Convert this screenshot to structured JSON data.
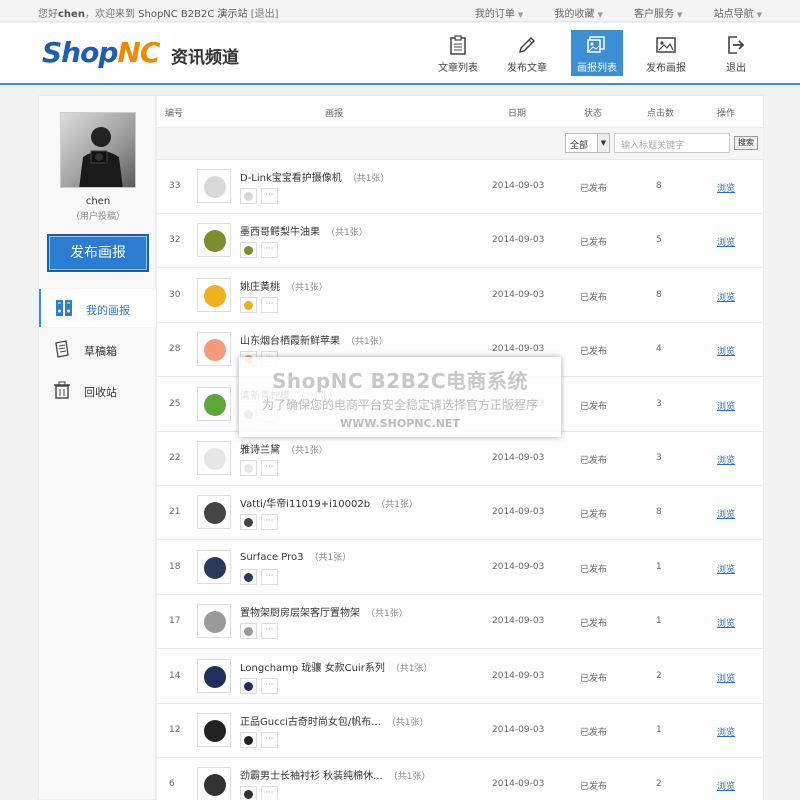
{
  "topbar": {
    "greeting_prefix": "您好",
    "username": "chen",
    "greeting_suffix": "，欢迎来到",
    "site_name": "ShopNC B2B2C 演示站",
    "logout": "[退出]",
    "links": [
      "我的订单",
      "我的收藏",
      "客户服务",
      "站点导航"
    ]
  },
  "header": {
    "logo_part1": "Shop",
    "logo_part2": "NC",
    "channel": "资讯频道",
    "nav": [
      {
        "label": "文章列表",
        "icon": "clipboard-icon"
      },
      {
        "label": "发布文章",
        "icon": "pencil-icon"
      },
      {
        "label": "画报列表",
        "icon": "picture-list-icon",
        "active": true
      },
      {
        "label": "发布画报",
        "icon": "picture-frame-icon"
      },
      {
        "label": "退出",
        "icon": "exit-icon"
      }
    ],
    "accent_color": "#3b8fd5"
  },
  "sidebar": {
    "user_name": "chen",
    "user_role": "（用户投稿）",
    "publish_button": "发布画报",
    "menu": [
      {
        "label": "我的画报",
        "icon": "binders-icon",
        "active": true
      },
      {
        "label": "草稿箱",
        "icon": "draft-icon"
      },
      {
        "label": "回收站",
        "icon": "trash-icon"
      }
    ]
  },
  "table": {
    "headers": {
      "id": "编号",
      "title": "画报",
      "date": "日期",
      "status": "状态",
      "clicks": "点击数",
      "op": "操作"
    },
    "filter": {
      "select_value": "全部",
      "placeholder": "输入标题关键字",
      "search_label": "搜索"
    },
    "count_text": "（共1张）",
    "more_text": "···",
    "rows": [
      {
        "id": "33",
        "title": "D-Link宝宝看护摄像机",
        "date": "2014-09-03",
        "status": "已发布",
        "clicks": "8",
        "op": "浏览",
        "color": "#d8d8d8"
      },
      {
        "id": "32",
        "title": "墨西哥鳄梨牛油果",
        "date": "2014-09-03",
        "status": "已发布",
        "clicks": "5",
        "op": "浏览",
        "color": "#7a8f2a"
      },
      {
        "id": "30",
        "title": "姚庄黄桃",
        "date": "2014-09-03",
        "status": "已发布",
        "clicks": "8",
        "op": "浏览",
        "color": "#f0b020"
      },
      {
        "id": "28",
        "title": "山东烟台栖霞新鲜苹果",
        "date": "2014-09-03",
        "status": "已发布",
        "clicks": "4",
        "op": "浏览",
        "color": "#f29a7a"
      },
      {
        "id": "25",
        "title": "清新青柠檬",
        "date": "2014-09-03",
        "status": "已发布",
        "clicks": "3",
        "op": "浏览",
        "color": "#5aa83a"
      },
      {
        "id": "22",
        "title": "雅诗兰黛",
        "date": "2014-09-03",
        "status": "已发布",
        "clicks": "3",
        "op": "浏览",
        "color": "#e6e6e6"
      },
      {
        "id": "21",
        "title": "Vatti/华帝i11019+i10002b",
        "date": "2014-09-03",
        "status": "已发布",
        "clicks": "8",
        "op": "浏览",
        "color": "#444444"
      },
      {
        "id": "18",
        "title": "Surface Pro3",
        "date": "2014-09-03",
        "status": "已发布",
        "clicks": "1",
        "op": "浏览",
        "color": "#2a3a5a"
      },
      {
        "id": "17",
        "title": "置物架厨房层架客厅置物架",
        "date": "2014-09-03",
        "status": "已发布",
        "clicks": "1",
        "op": "浏览",
        "color": "#9a9a9a"
      },
      {
        "id": "14",
        "title": "Longchamp 珑骧 女款Cuir系列",
        "date": "2014-09-03",
        "status": "已发布",
        "clicks": "2",
        "op": "浏览",
        "color": "#1f2e5a"
      },
      {
        "id": "12",
        "title": "正品Gucci古奇时尚女包/帆布...",
        "date": "2014-09-03",
        "status": "已发布",
        "clicks": "1",
        "op": "浏览",
        "color": "#222222"
      },
      {
        "id": "6",
        "title": "劲霸男士长袖衬衫 秋装纯棉休...",
        "date": "2014-09-03",
        "status": "已发布",
        "clicks": "2",
        "op": "浏览",
        "color": "#333333"
      }
    ]
  },
  "watermark": {
    "title": "ShopNC B2B2C电商系统",
    "subtitle": "为了确保您的电商平台安全稳定请选择官方正版程序",
    "url": "WWW.SHOPNC.NET"
  }
}
